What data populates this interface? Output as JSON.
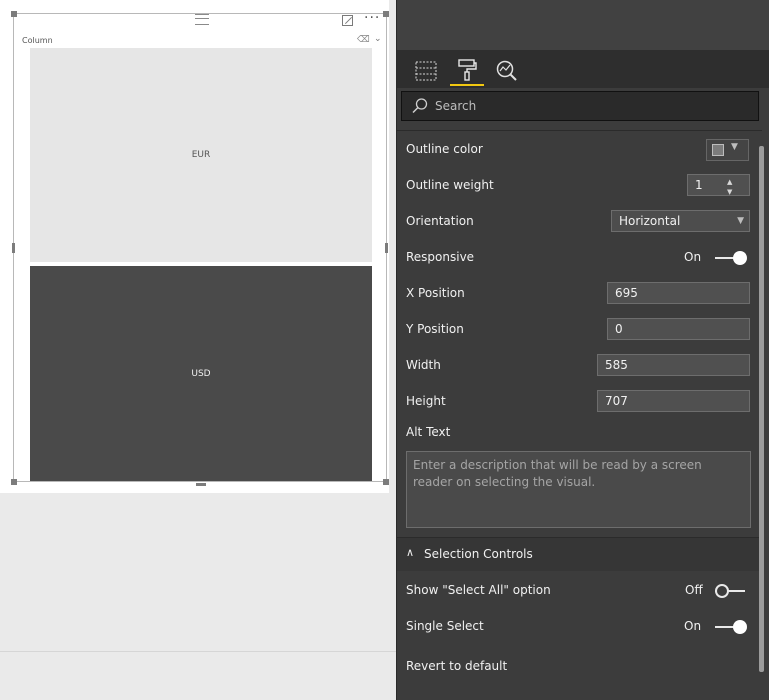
{
  "visual": {
    "title": "Column",
    "tiles": [
      {
        "label": "EUR"
      },
      {
        "label": "USD"
      }
    ],
    "more_glyph": "···"
  },
  "pane": {
    "tabs": [
      {
        "name": "fields-icon",
        "active": false
      },
      {
        "name": "format-paint-roller-icon",
        "active": true
      },
      {
        "name": "analytics-magnifier-icon",
        "active": false
      }
    ],
    "search": {
      "placeholder": "Search"
    },
    "general": {
      "outline_color_label": "Outline color",
      "outline_color_value": "#7c7c7c",
      "outline_weight_label": "Outline weight",
      "outline_weight_value": "1",
      "orientation_label": "Orientation",
      "orientation_value": "Horizontal",
      "responsive_label": "Responsive",
      "responsive_state": "On",
      "x_position_label": "X Position",
      "x_position_value": "695",
      "y_position_label": "Y Position",
      "y_position_value": "0",
      "width_label": "Width",
      "width_value": "585",
      "height_label": "Height",
      "height_value": "707",
      "alt_text_label": "Alt Text",
      "alt_text_placeholder": "Enter a description that will be read by a screen reader on selecting the visual."
    },
    "selection_controls": {
      "title": "Selection Controls",
      "show_select_all_label": "Show \"Select All\" option",
      "show_select_all_state": "Off",
      "single_select_label": "Single Select",
      "single_select_state": "On"
    },
    "revert_label": "Revert to default"
  },
  "colors": {
    "accent": "#f2c811",
    "pane_bg": "#3c3c3c",
    "tile_light": "#e6e6e6",
    "tile_dark": "#4a4a4a"
  }
}
